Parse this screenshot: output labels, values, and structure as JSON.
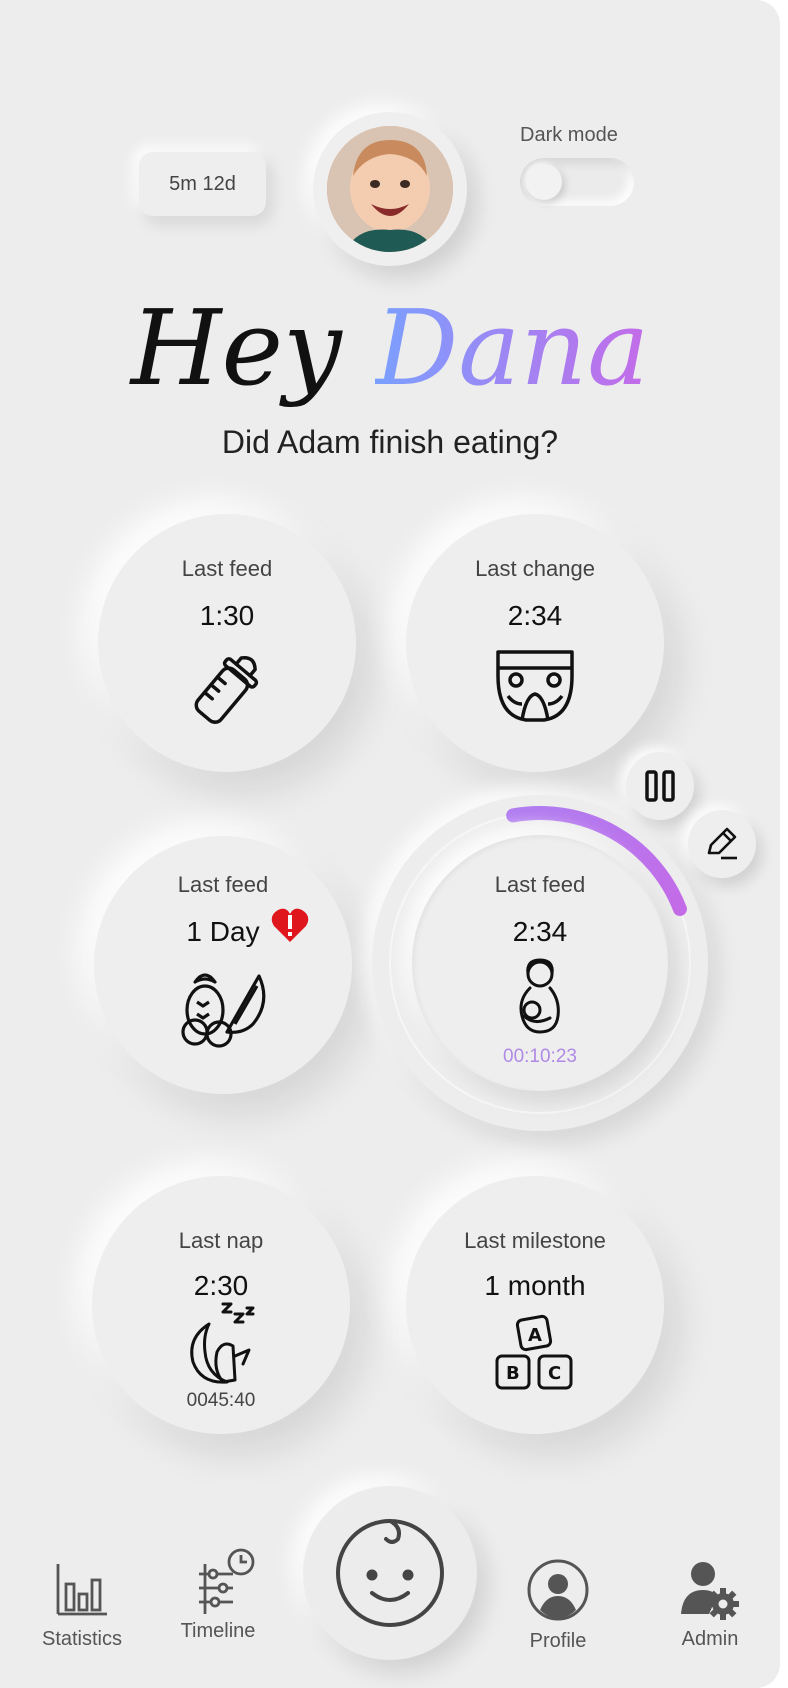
{
  "header": {
    "age": "5m 12d",
    "dark_mode_label": "Dark mode",
    "dark_mode_on": false
  },
  "greeting": {
    "hey": "Hey",
    "name": "Dana",
    "question": "Did Adam finish eating?"
  },
  "cards": {
    "feed_bottle": {
      "label": "Last feed",
      "value": "1:30",
      "icon": "baby-bottle-icon"
    },
    "change": {
      "label": "Last change",
      "value": "2:34",
      "icon": "diaper-icon"
    },
    "feed_solid": {
      "label": "Last feed",
      "value": "1 Day",
      "icon": "fruit-icon",
      "alert_icon": "heart-alert-icon"
    },
    "feed_breast": {
      "label": "Last feed",
      "value": "2:34",
      "timer": "00:10:23",
      "icon": "breastfeeding-icon",
      "progress": 0.22
    },
    "nap": {
      "label": "Last nap",
      "value": "2:30",
      "timer": "0045:40",
      "icon": "sleeping-moon-icon"
    },
    "milestone": {
      "label": "Last milestone",
      "value": "1 month",
      "icon": "abc-blocks-icon"
    }
  },
  "controls": {
    "pause_icon": "pause-icon",
    "edit_icon": "pencil-icon"
  },
  "nav": [
    {
      "label": "Statistics",
      "icon": "bar-chart-icon"
    },
    {
      "label": "Timeline",
      "icon": "timeline-clock-icon"
    },
    {
      "label": "",
      "icon": "baby-face-icon"
    },
    {
      "label": "Profile",
      "icon": "profile-icon"
    },
    {
      "label": "Admin",
      "icon": "admin-gear-icon"
    }
  ],
  "colors": {
    "background": "#ededed",
    "accent_start": "#7aa0ff",
    "accent_end": "#c46be8",
    "alert": "#e0161d"
  }
}
